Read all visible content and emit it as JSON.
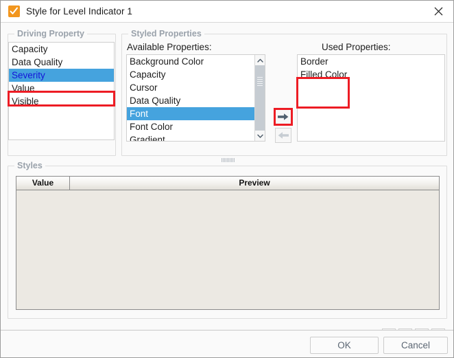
{
  "window": {
    "title": "Style for Level Indicator 1",
    "icon": "checkmark-icon",
    "close_label": "✕",
    "accent_selection_color": "#45a3de",
    "annotation_color": "#ed1c24",
    "icon_color": "#f2961e"
  },
  "driving_property": {
    "group_title": "Driving Property",
    "items": [
      {
        "label": "Capacity",
        "selected": false
      },
      {
        "label": "Data Quality",
        "selected": false
      },
      {
        "label": "Severity",
        "selected": true
      },
      {
        "label": "Value",
        "selected": false
      },
      {
        "label": "Visible",
        "selected": false
      }
    ]
  },
  "styled_properties": {
    "group_title": "Styled Properties",
    "available_label": "Available Properties:",
    "used_label": "Used Properties:",
    "available_items": [
      {
        "label": "Background Color",
        "selected": false
      },
      {
        "label": "Capacity",
        "selected": false
      },
      {
        "label": "Cursor",
        "selected": false
      },
      {
        "label": "Data Quality",
        "selected": false
      },
      {
        "label": "Font",
        "selected": true
      },
      {
        "label": "Font Color",
        "selected": false
      },
      {
        "label": "Gradient",
        "selected": false
      }
    ],
    "used_items": [
      {
        "label": "Border"
      },
      {
        "label": "Filled Color"
      }
    ],
    "add_button": "add-to-used-arrow-right",
    "remove_button": "remove-from-used-arrow-left"
  },
  "styles": {
    "group_title": "Styles",
    "columns": [
      "Value",
      "Preview"
    ],
    "rows": [],
    "toolbar": [
      {
        "name": "add-style-button",
        "glyph": "plus"
      },
      {
        "name": "delete-style-button",
        "glyph": "trash"
      },
      {
        "name": "copy-style-button",
        "glyph": "copy"
      },
      {
        "name": "paste-style-button",
        "glyph": "paste"
      }
    ]
  },
  "footer": {
    "ok_label": "OK",
    "cancel_label": "Cancel"
  }
}
